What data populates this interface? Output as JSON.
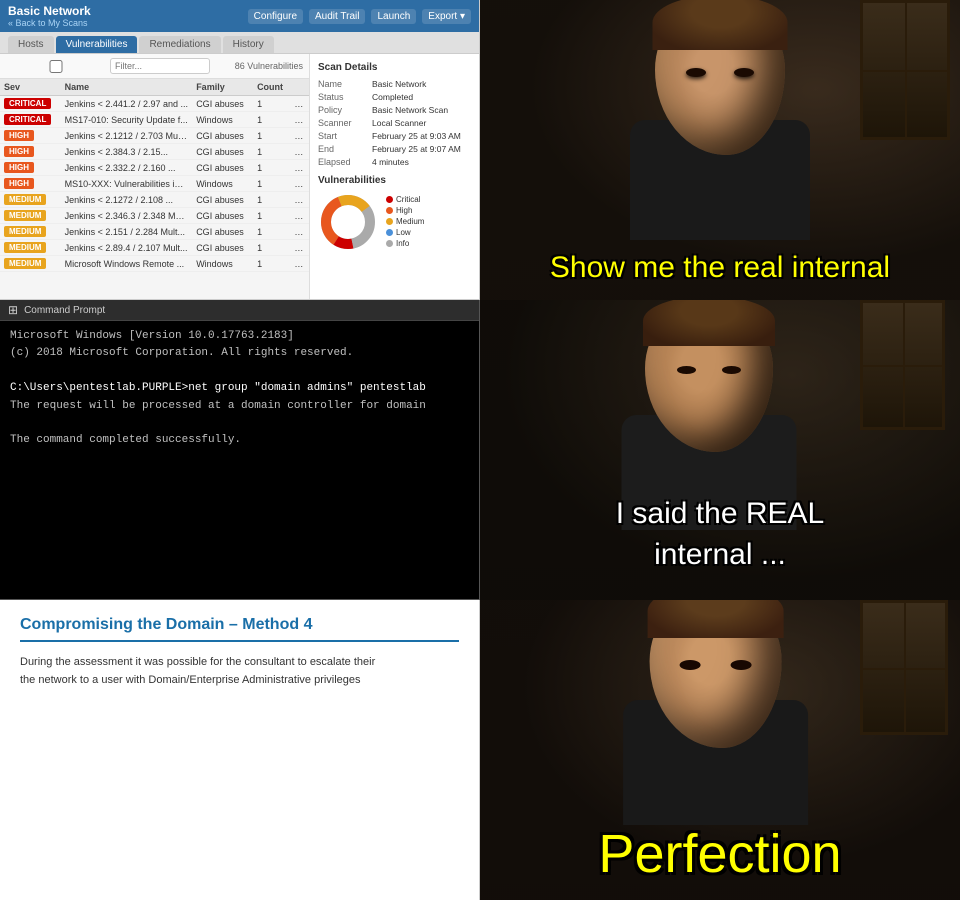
{
  "nessus": {
    "title": "Basic Network",
    "back_link": "« Back to My Scans",
    "topbar_buttons": [
      "Configure",
      "Audit Trail",
      "Launch",
      "Export"
    ],
    "tabs": [
      "Hosts",
      "Vulnerabilities",
      "Remediations",
      "History"
    ],
    "active_tab": "Vulnerabilities",
    "filter_placeholder": "Filter...",
    "vuln_count": "86 Vulnerabilities",
    "table_headers": [
      "Sev",
      "Name",
      "Family",
      "Count"
    ],
    "vulnerabilities": [
      {
        "sev": "CRITICAL",
        "name": "Jenkins < 2.441.2 / 2.97 and ...",
        "family": "CGI abuses",
        "count": "1"
      },
      {
        "sev": "CRITICAL",
        "name": "MS17-010: Security Update f...",
        "family": "Windows",
        "count": "1"
      },
      {
        "sev": "HIGH",
        "name": "Jenkins < 2.1212 / 2.703 Mult...",
        "family": "CGI abuses",
        "count": "1"
      },
      {
        "sev": "HIGH",
        "name": "Jenkins < 2.384.3 / 2.15...",
        "family": "CGI abuses",
        "count": "1"
      },
      {
        "sev": "HIGH",
        "name": "Jenkins < 2.332.2 / 2.160 ...",
        "family": "CGI abuses",
        "count": "1"
      },
      {
        "sev": "HIGH",
        "name": "MS10-XXX: Vulnerabilities in ...",
        "family": "Windows",
        "count": "1"
      },
      {
        "sev": "MEDIUM",
        "name": "Jenkins < 2.1272 / 2.108 ...",
        "family": "CGI abuses",
        "count": "1"
      },
      {
        "sev": "MEDIUM",
        "name": "Jenkins < 2.346.3 / 2.348 Mult...",
        "family": "CGI abuses",
        "count": "1"
      },
      {
        "sev": "MEDIUM",
        "name": "Jenkins < 2.151 / 2.284 Mult...",
        "family": "CGI abuses",
        "count": "1"
      },
      {
        "sev": "MEDIUM",
        "name": "Jenkins < 2.89.4 / 2.107 Mult...",
        "family": "CGI abuses",
        "count": "1"
      },
      {
        "sev": "MEDIUM",
        "name": "Microsoft Windows Remote ...",
        "family": "Windows",
        "count": "1"
      }
    ],
    "scan_details": {
      "title": "Scan Details",
      "name_label": "Name",
      "name_value": "Basic Network",
      "status_label": "Status",
      "status_value": "Completed",
      "policy_label": "Policy",
      "policy_value": "Basic Network Scan",
      "scanner_label": "Scanner",
      "scanner_value": "Local Scanner",
      "start_label": "Start",
      "start_value": "February 25 at 9:03 AM",
      "end_label": "End",
      "end_value": "February 25 at 9:07 AM",
      "elapsed_label": "Elapsed",
      "elapsed_value": "4 minutes"
    },
    "vuln_chart_title": "Vulnerabilities",
    "legend": [
      {
        "label": "Critical",
        "color": "#cc0000"
      },
      {
        "label": "High",
        "color": "#e8571e"
      },
      {
        "label": "Medium",
        "color": "#e8a41e"
      },
      {
        "label": "Low",
        "color": "#4a90d9"
      },
      {
        "label": "Info",
        "color": "#aaa"
      }
    ]
  },
  "cmd": {
    "titlebar": "Command Prompt",
    "lines": [
      "Microsoft Windows [Version 10.0.17763.2183]",
      "(c) 2018 Microsoft Corporation. All rights reserved.",
      "",
      "C:\\Users\\pentestlab.PURPLE>net group \"domain admins\" pentestlab",
      "The request will be processed at a domain controller for domain",
      "",
      "The command completed successfully.",
      ""
    ]
  },
  "report": {
    "title": "Compromising the Domain – Method 4",
    "body": "During the assessment it was possible for the consultant to escalate their\nthe network to a user with Domain/Enterprise Administrative privileges"
  },
  "meme": {
    "panel1_text": "Show me the real internal",
    "panel2_line1": "I said the REAL",
    "panel2_line2": "internal ...",
    "panel3_text": "Perfection"
  }
}
